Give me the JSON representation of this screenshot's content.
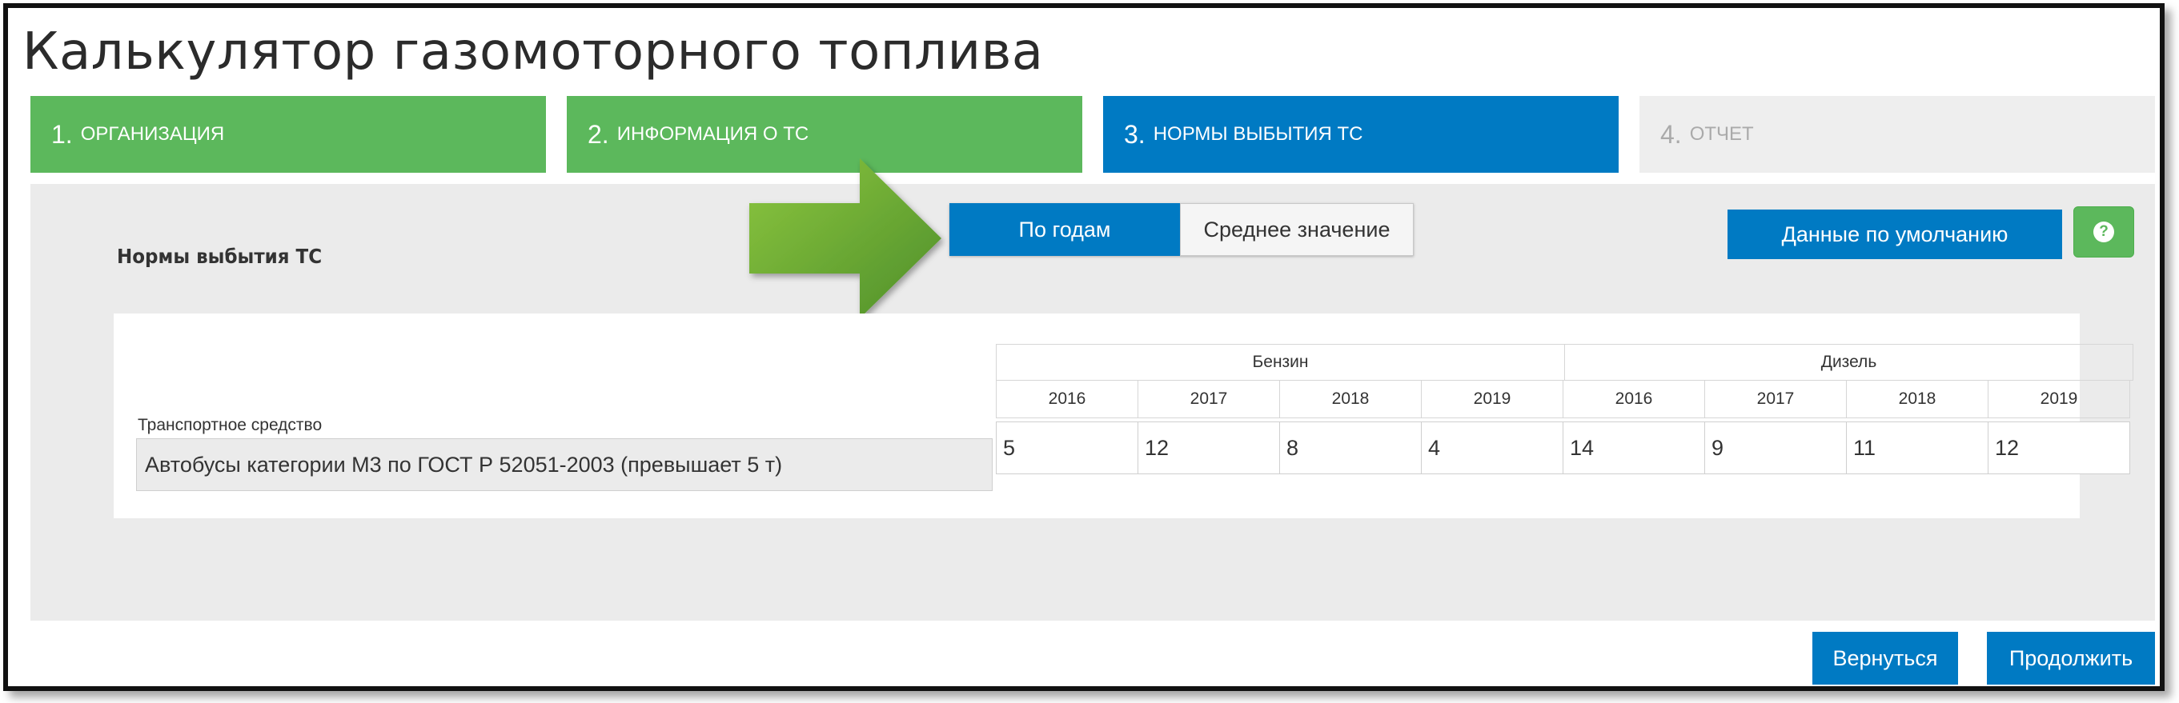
{
  "app": {
    "title": "Калькулятор газомоторного топлива"
  },
  "steps": [
    {
      "num": "1.",
      "label": "Организация",
      "state": "done"
    },
    {
      "num": "2.",
      "label": "Информация о ТС",
      "state": "done"
    },
    {
      "num": "3.",
      "label": "Нормы выбытия ТС",
      "state": "active"
    },
    {
      "num": "4.",
      "label": "Отчет",
      "state": "todo"
    }
  ],
  "section": {
    "title": "Нормы выбытия ТС"
  },
  "toggle": {
    "by_year": "По годам",
    "average": "Среднее значение",
    "selected": "by_year"
  },
  "buttons": {
    "defaults": "Данные по умолчанию",
    "help_icon": "question-circle-icon",
    "back": "Вернуться",
    "next": "Продолжить"
  },
  "table": {
    "vehicle_header": "Транспортное средство",
    "fuels": [
      {
        "name": "Бензин",
        "years": [
          "2016",
          "2017",
          "2018",
          "2019"
        ]
      },
      {
        "name": "Дизель",
        "years": [
          "2016",
          "2017",
          "2018",
          "2019"
        ]
      }
    ],
    "rows": [
      {
        "vehicle": "Автобусы категории М3 по ГОСТ Р 52051-2003 (превышает 5 т)",
        "values": [
          "5",
          "12",
          "8",
          "4",
          "14",
          "9",
          "11",
          "12"
        ]
      }
    ]
  },
  "colors": {
    "green": "#5cb85c",
    "blue": "#007ac3",
    "inactive": "#eeeeee",
    "panel": "#ebebeb"
  }
}
